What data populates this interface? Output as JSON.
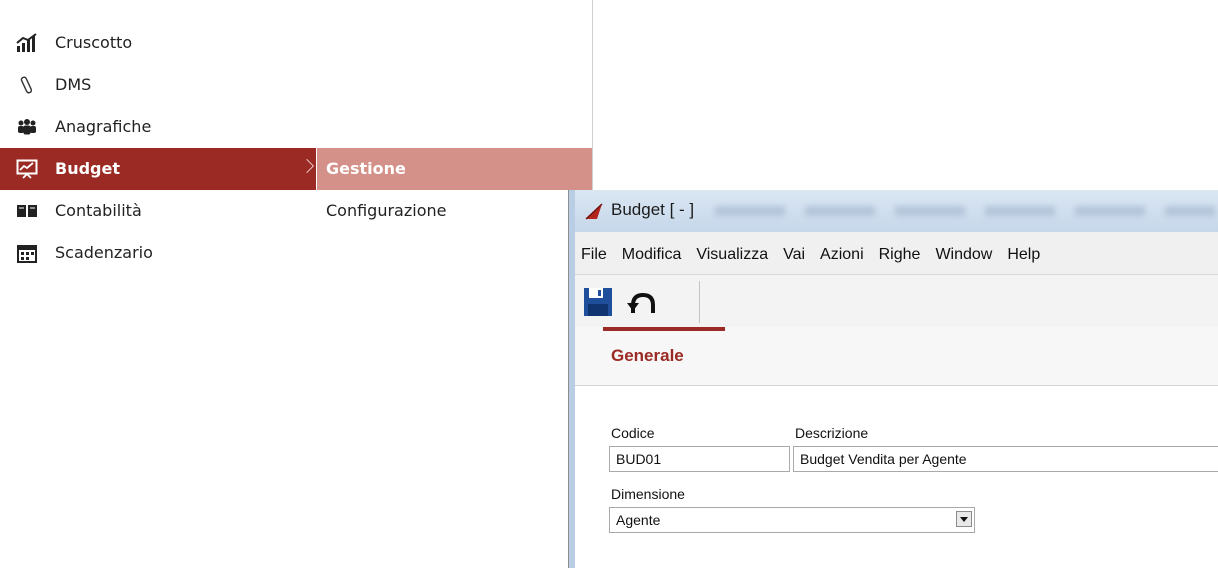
{
  "nav_menu": {
    "items": [
      {
        "label": "Cruscotto",
        "icon": "dashboard-chart-icon"
      },
      {
        "label": "DMS",
        "icon": "paperclip-icon"
      },
      {
        "label": "Anagrafiche",
        "icon": "people-group-icon"
      },
      {
        "label": "Budget",
        "icon": "presentation-chart-icon",
        "active": true
      },
      {
        "label": "Contabilità",
        "icon": "book-icon"
      },
      {
        "label": "Scadenzario",
        "icon": "calendar-icon"
      }
    ],
    "submenu": [
      {
        "label": "Gestione",
        "highlighted": true
      },
      {
        "label": "Configurazione"
      }
    ]
  },
  "window": {
    "title": "Budget [ - ]",
    "menubar": [
      "File",
      "Modifica",
      "Visualizza",
      "Vai",
      "Azioni",
      "Righe",
      "Window",
      "Help"
    ],
    "toolbar": {
      "save": "save-icon",
      "undo": "undo-icon"
    },
    "tabs": [
      {
        "label": "Generale",
        "active": true
      }
    ],
    "form": {
      "codice_label": "Codice",
      "codice_value": "BUD01",
      "descrizione_label": "Descrizione",
      "descrizione_value": "Budget Vendita per Agente",
      "dimensione_label": "Dimensione",
      "dimensione_value": "Agente"
    }
  },
  "colors": {
    "accent": "#9b2a24",
    "submenu_highlight": "#d49189",
    "save_icon": "#1f4e9a"
  }
}
